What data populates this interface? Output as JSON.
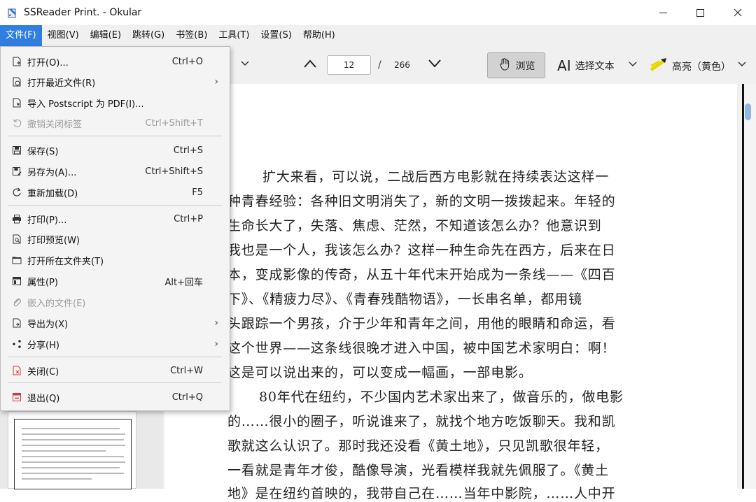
{
  "window": {
    "title": "SSReader Print.  - Okular"
  },
  "menubar": [
    "文件(F)",
    "视图(V)",
    "编辑(E)",
    "跳转(G)",
    "书签(B)",
    "工具(T)",
    "设置(S)",
    "帮助(H)"
  ],
  "toolbar": {
    "page_current": "12",
    "page_sep": "/",
    "page_total": "266",
    "browse": "浏览",
    "select_text": "选择文本",
    "highlight": "高亮（黄色）"
  },
  "file_menu": [
    {
      "label": "打开(O)...",
      "shortcut": "Ctrl+O",
      "icon": "open-icon"
    },
    {
      "label": "打开最近文件(R)",
      "submenu": true,
      "icon": "recent-icon"
    },
    {
      "label": "导入 Postscript 为 PDF(I)...",
      "icon": "import-icon"
    },
    {
      "label": "撤销关闭标签",
      "shortcut": "Ctrl+Shift+T",
      "disabled": true,
      "icon": "undo-icon"
    },
    {
      "label": "保存(S)",
      "shortcut": "Ctrl+S",
      "icon": "save-icon"
    },
    {
      "label": "另存为(A)...",
      "shortcut": "Ctrl+Shift+S",
      "icon": "save-as-icon"
    },
    {
      "label": "重新加载(D)",
      "shortcut": "F5",
      "icon": "reload-icon"
    },
    {
      "label": "打印(P)...",
      "shortcut": "Ctrl+P",
      "icon": "print-icon"
    },
    {
      "label": "打印预览(W)",
      "icon": "print-preview-icon"
    },
    {
      "label": "打开所在文件夹(T)",
      "icon": "folder-icon"
    },
    {
      "label": "属性(P)",
      "shortcut": "Alt+回车",
      "icon": "properties-icon"
    },
    {
      "label": "嵌入的文件(E)",
      "disabled": true,
      "icon": "attachment-icon"
    },
    {
      "label": "导出为(X)",
      "submenu": true,
      "icon": "export-icon"
    },
    {
      "label": "分享(H)",
      "submenu": true,
      "icon": "share-icon"
    },
    {
      "label": "关闭(C)",
      "shortcut": "Ctrl+W",
      "icon": "close-doc-icon"
    },
    {
      "label": "退出(Q)",
      "shortcut": "Ctrl+Q",
      "icon": "quit-icon"
    }
  ],
  "document": {
    "lines": [
      "扩大来看，可以说，二战后西方电影就在持续表达这样一",
      "种青春经验：各种旧文明消失了，新的文明一拨拨起来。年轻的",
      "生命长大了，失落、焦虑、茫然，不知道该怎么办？他意识到",
      "我也是一个人，我该怎么办？这样一种生命先在西方，后来在日",
      "本，变成影像的传奇，从五十年代末开始成为一条线——《四百",
      "下》、《精疲力尽》、《青春残酷物语》，一长串名单，都用镜",
      "头跟踪一个男孩，介于少年和青年之间，用他的眼睛和命运，看",
      "这个世界——这条线很晚才进入中国，被中国艺术家明白：啊！",
      "这是可以说出来的，可以变成一幅画，一部电影。",
      "80年代在纽约，不少国内艺术家出来了，做音乐的，做电影",
      "的……很小的圈子，听说谁来了，就找个地方吃饭聊天。我和凯",
      "歌就这么认识了。那时我还没看《黄土地》，只见凯歌很年轻，",
      "一看就是青年才俊，酷像导演，光看模样我就先佩服了。《黄土",
      "地》是在纽约首映的，我带自己在……当年中影院，……人中开"
    ]
  }
}
